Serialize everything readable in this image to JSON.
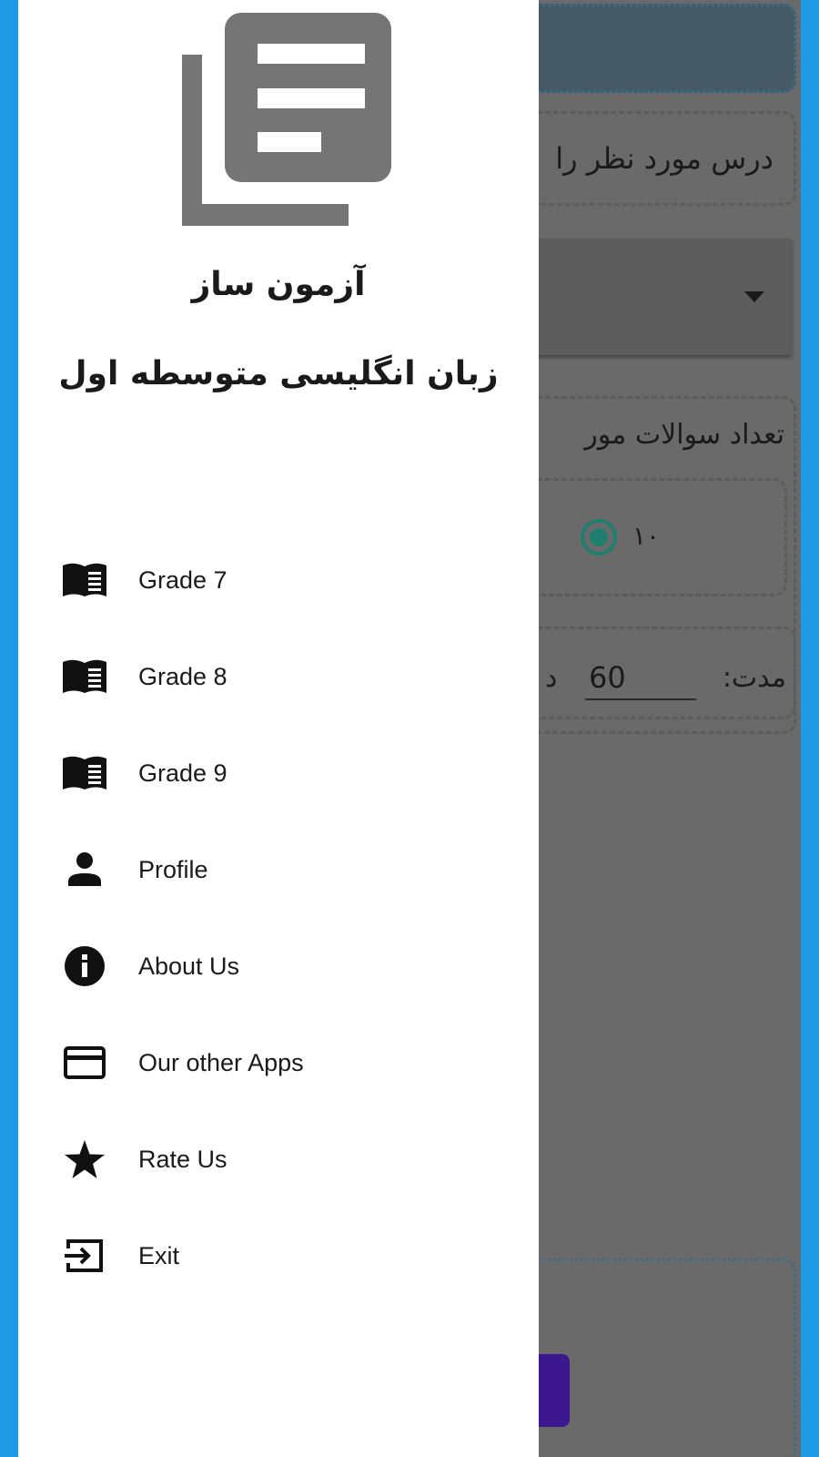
{
  "drawer": {
    "title": "آزمون ساز",
    "subtitle": "زبان انگلیسی متوسطه اول",
    "logo_icon": "document-stack-icon",
    "menu": [
      {
        "label": "Grade 7",
        "icon": "book-icon"
      },
      {
        "label": "Grade 8",
        "icon": "book-icon"
      },
      {
        "label": "Grade 9",
        "icon": "book-icon"
      },
      {
        "label": "Profile",
        "icon": "person-icon"
      },
      {
        "label": "About Us",
        "icon": "info-icon"
      },
      {
        "label": "Our other Apps",
        "icon": "card-icon"
      },
      {
        "label": "Rate Us",
        "icon": "star-icon"
      },
      {
        "label": "Exit",
        "icon": "exit-icon"
      }
    ]
  },
  "background": {
    "lesson_prompt": "درس مورد نظر را",
    "question_count_label": "تعداد سوالات مور",
    "radio_option": "۱۰",
    "duration_label": "مدت:",
    "duration_value": "60",
    "duration_unit": "د"
  },
  "colors": {
    "frame": "#1e9be4",
    "scrim": "#6a6a6a",
    "drawer_bg": "#ffffff",
    "icon_gray": "#757575",
    "accent_green": "#1f7f6f",
    "button_purple": "#3d1790"
  }
}
